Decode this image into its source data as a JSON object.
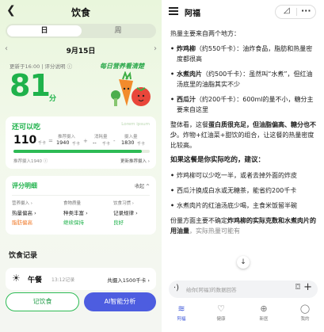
{
  "left": {
    "back_icon": "chevron-left-icon",
    "title": "饮食",
    "segment": {
      "day": "日",
      "week": "周"
    },
    "date": {
      "text": "9月15日",
      "prev": "‹",
      "next": "›"
    },
    "update_text": "更新于16:00 | 评分说明 ⓘ",
    "score": "81",
    "score_unit": "分",
    "banner": "每日营养看清楚",
    "can_eat": {
      "title": "还可以吃",
      "tag": "Lorem ipsum",
      "remaining": "110",
      "unit": "千卡",
      "eq": "=",
      "recommended_label": "推荐摄入",
      "recommended_value": "1940",
      "minus1": "+",
      "burned_label": "消耗量",
      "burned_value": "--",
      "minus2": "-",
      "intake_label": "摄入量",
      "intake_value": "1830",
      "progress_percent": 94,
      "foot_left": "推荐摄入1940 ⓘ",
      "foot_right": "更新推荐摄入 ›"
    },
    "detail": {
      "title": "评分明细",
      "fold": "收起 ^",
      "columns": [
        {
          "head": "营养摄入 ›",
          "value": "热量偏高 ›",
          "status": "脂肪偏高",
          "color": "#f07a2a"
        },
        {
          "head": "食物质量",
          "value": "种类丰富 ›",
          "status": "继续保持",
          "color": "#1fb24b"
        },
        {
          "head": "饮食习惯 ›",
          "value": "记录规律 ›",
          "status": "良好",
          "color": "#1fb24b"
        }
      ]
    },
    "records_title": "饮食记录",
    "meal": {
      "icon": "sun-icon",
      "name": "午餐",
      "time": "13:12记录",
      "kcal": "共摄入1500千卡 ›"
    },
    "buttons": {
      "record": "记饮食",
      "ai": "AI智能分析"
    }
  },
  "right": {
    "title": "阿福",
    "pill_a": "◿",
    "pill_b": "···",
    "intro": "热量主要来自两个地方：",
    "items": [
      {
        "name": "炸鸡柳",
        "rest": "（约550千卡）：油炸食品，脂肪和热量密度都很高"
      },
      {
        "name": "水煮肉片",
        "rest": "（约500千卡）：虽然叫“水煮”，但红油汤底里的油脂其实不少"
      },
      {
        "name": "西瓜汁",
        "rest": "（约200千卡）：600ml的量不小，糖分主要来自这里"
      }
    ],
    "summary_pre": "整体看，这餐",
    "summary_bold": "蛋白质很充足，但油脂偏高、糖分也不少",
    "summary_post": "。炸物+红油菜+甜饮的组合，让这餐的热量密度比较高。",
    "advice_title": "如果这餐是你实际吃的，建议：",
    "advice": [
      "炸鸡柳可以少吃一半，或者去掉外面的炸皮",
      "西瓜汁换成白水或无糖茶，能省约200千卡",
      "水煮肉片的红油汤底少喝，主食米饭留半碗"
    ],
    "footer_pre": "份量方面主要不确定",
    "footer_bold": "炸鸡柳的实际克数和水煮肉片的用油量",
    "footer_post": "，实际热量可能有",
    "scroll_icon": "↓",
    "input_placeholder": "给你[阿福]的数据回答",
    "input_left_icon": "voice-wave-icon",
    "input_cam_icon": "camera-icon",
    "input_plus_icon": "plus-icon",
    "tabs": [
      {
        "icon": "≋",
        "label": "阿福",
        "active": true
      },
      {
        "icon": "♡",
        "label": "健康",
        "active": false
      },
      {
        "icon": "⊕",
        "label": "新医",
        "active": false
      },
      {
        "icon": "◯",
        "label": "我的",
        "active": false
      }
    ]
  }
}
